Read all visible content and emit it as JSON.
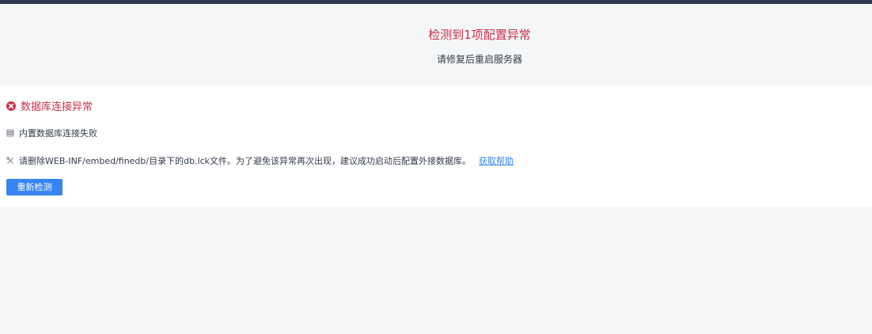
{
  "header": {
    "title": "检测到1项配置异常",
    "subtitle": "请修复后重启服务器"
  },
  "error": {
    "icon": "close-circle-icon",
    "title": "数据库连接异常",
    "items": [
      {
        "icon": "server-icon",
        "text": "内置数据库连接失败"
      },
      {
        "icon": "tools-icon",
        "text": "请删除WEB-INF/embed/finedb/目录下的db.lck文件。为了避免该异常再次出现，建议成功启动后配置外接数据库。",
        "link": "获取帮助"
      }
    ]
  },
  "actions": {
    "recheck_label": "重新检测"
  },
  "colors": {
    "topbar": "#2f3a53",
    "error": "#c8324a",
    "link": "#3685f2",
    "button": "#3685f2",
    "background": "#f5f6f8"
  }
}
